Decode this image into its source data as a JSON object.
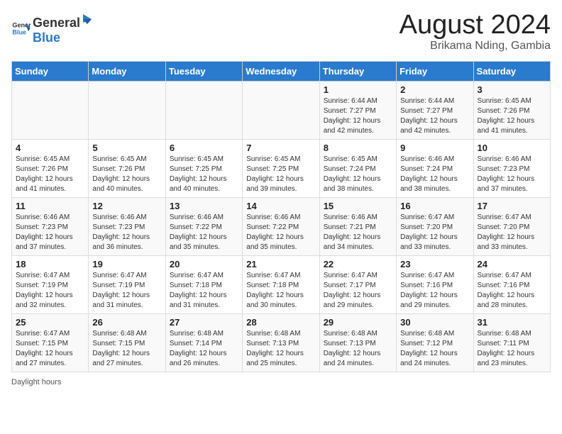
{
  "header": {
    "logo_general": "General",
    "logo_blue": "Blue",
    "main_title": "August 2024",
    "subtitle": "Brikama Nding, Gambia"
  },
  "days_of_week": [
    "Sunday",
    "Monday",
    "Tuesday",
    "Wednesday",
    "Thursday",
    "Friday",
    "Saturday"
  ],
  "weeks": [
    [
      {
        "day": "",
        "info": ""
      },
      {
        "day": "",
        "info": ""
      },
      {
        "day": "",
        "info": ""
      },
      {
        "day": "",
        "info": ""
      },
      {
        "day": "1",
        "info": "Sunrise: 6:44 AM\nSunset: 7:27 PM\nDaylight: 12 hours\nand 42 minutes."
      },
      {
        "day": "2",
        "info": "Sunrise: 6:44 AM\nSunset: 7:27 PM\nDaylight: 12 hours\nand 42 minutes."
      },
      {
        "day": "3",
        "info": "Sunrise: 6:45 AM\nSunset: 7:26 PM\nDaylight: 12 hours\nand 41 minutes."
      }
    ],
    [
      {
        "day": "4",
        "info": "Sunrise: 6:45 AM\nSunset: 7:26 PM\nDaylight: 12 hours\nand 41 minutes."
      },
      {
        "day": "5",
        "info": "Sunrise: 6:45 AM\nSunset: 7:26 PM\nDaylight: 12 hours\nand 40 minutes."
      },
      {
        "day": "6",
        "info": "Sunrise: 6:45 AM\nSunset: 7:25 PM\nDaylight: 12 hours\nand 40 minutes."
      },
      {
        "day": "7",
        "info": "Sunrise: 6:45 AM\nSunset: 7:25 PM\nDaylight: 12 hours\nand 39 minutes."
      },
      {
        "day": "8",
        "info": "Sunrise: 6:45 AM\nSunset: 7:24 PM\nDaylight: 12 hours\nand 38 minutes."
      },
      {
        "day": "9",
        "info": "Sunrise: 6:46 AM\nSunset: 7:24 PM\nDaylight: 12 hours\nand 38 minutes."
      },
      {
        "day": "10",
        "info": "Sunrise: 6:46 AM\nSunset: 7:23 PM\nDaylight: 12 hours\nand 37 minutes."
      }
    ],
    [
      {
        "day": "11",
        "info": "Sunrise: 6:46 AM\nSunset: 7:23 PM\nDaylight: 12 hours\nand 37 minutes."
      },
      {
        "day": "12",
        "info": "Sunrise: 6:46 AM\nSunset: 7:23 PM\nDaylight: 12 hours\nand 36 minutes."
      },
      {
        "day": "13",
        "info": "Sunrise: 6:46 AM\nSunset: 7:22 PM\nDaylight: 12 hours\nand 35 minutes."
      },
      {
        "day": "14",
        "info": "Sunrise: 6:46 AM\nSunset: 7:22 PM\nDaylight: 12 hours\nand 35 minutes."
      },
      {
        "day": "15",
        "info": "Sunrise: 6:46 AM\nSunset: 7:21 PM\nDaylight: 12 hours\nand 34 minutes."
      },
      {
        "day": "16",
        "info": "Sunrise: 6:47 AM\nSunset: 7:20 PM\nDaylight: 12 hours\nand 33 minutes."
      },
      {
        "day": "17",
        "info": "Sunrise: 6:47 AM\nSunset: 7:20 PM\nDaylight: 12 hours\nand 33 minutes."
      }
    ],
    [
      {
        "day": "18",
        "info": "Sunrise: 6:47 AM\nSunset: 7:19 PM\nDaylight: 12 hours\nand 32 minutes."
      },
      {
        "day": "19",
        "info": "Sunrise: 6:47 AM\nSunset: 7:19 PM\nDaylight: 12 hours\nand 31 minutes."
      },
      {
        "day": "20",
        "info": "Sunrise: 6:47 AM\nSunset: 7:18 PM\nDaylight: 12 hours\nand 31 minutes."
      },
      {
        "day": "21",
        "info": "Sunrise: 6:47 AM\nSunset: 7:18 PM\nDaylight: 12 hours\nand 30 minutes."
      },
      {
        "day": "22",
        "info": "Sunrise: 6:47 AM\nSunset: 7:17 PM\nDaylight: 12 hours\nand 29 minutes."
      },
      {
        "day": "23",
        "info": "Sunrise: 6:47 AM\nSunset: 7:16 PM\nDaylight: 12 hours\nand 29 minutes."
      },
      {
        "day": "24",
        "info": "Sunrise: 6:47 AM\nSunset: 7:16 PM\nDaylight: 12 hours\nand 28 minutes."
      }
    ],
    [
      {
        "day": "25",
        "info": "Sunrise: 6:47 AM\nSunset: 7:15 PM\nDaylight: 12 hours\nand 27 minutes."
      },
      {
        "day": "26",
        "info": "Sunrise: 6:48 AM\nSunset: 7:15 PM\nDaylight: 12 hours\nand 27 minutes."
      },
      {
        "day": "27",
        "info": "Sunrise: 6:48 AM\nSunset: 7:14 PM\nDaylight: 12 hours\nand 26 minutes."
      },
      {
        "day": "28",
        "info": "Sunrise: 6:48 AM\nSunset: 7:13 PM\nDaylight: 12 hours\nand 25 minutes."
      },
      {
        "day": "29",
        "info": "Sunrise: 6:48 AM\nSunset: 7:13 PM\nDaylight: 12 hours\nand 24 minutes."
      },
      {
        "day": "30",
        "info": "Sunrise: 6:48 AM\nSunset: 7:12 PM\nDaylight: 12 hours\nand 24 minutes."
      },
      {
        "day": "31",
        "info": "Sunrise: 6:48 AM\nSunset: 7:11 PM\nDaylight: 12 hours\nand 23 minutes."
      }
    ]
  ],
  "footer": {
    "label": "Daylight hours"
  }
}
